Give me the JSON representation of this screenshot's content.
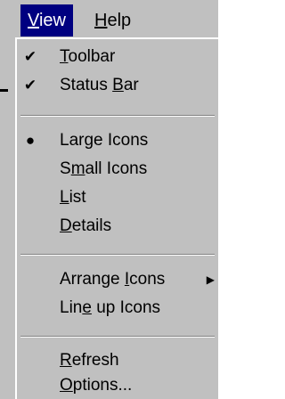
{
  "menubar": {
    "view_label": "View",
    "help_label": "Help"
  },
  "view_menu": {
    "toolbar": "Toolbar",
    "status_bar": "Status Bar",
    "large_icons": "Large Icons",
    "small_icons": "Small Icons",
    "list": "List",
    "details": "Details",
    "arrange_icons": "Arrange Icons",
    "line_up_icons": "Line up Icons",
    "refresh": "Refresh",
    "options": "Options..."
  },
  "state": {
    "toolbar_checked": true,
    "status_bar_checked": true,
    "selected_view": "Large Icons"
  },
  "colors": {
    "menu_bg": "#c0c0c0",
    "highlight": "#000080",
    "highlight_text": "#ffffff"
  },
  "icons": {
    "check": "checkmark-icon",
    "radio": "radio-bullet-icon",
    "submenu": "submenu-arrow-icon"
  }
}
